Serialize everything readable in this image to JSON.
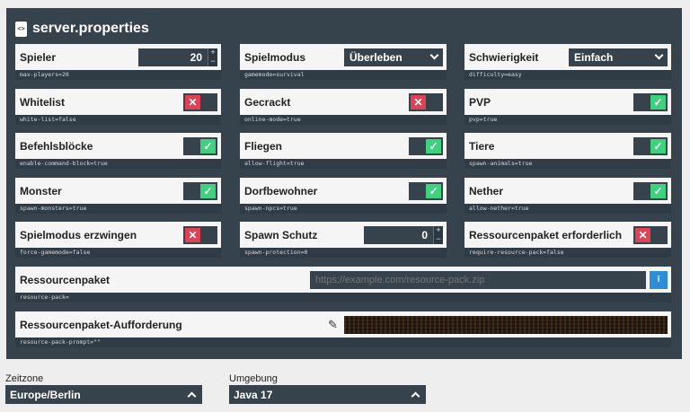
{
  "title": "server.properties",
  "file_icon_glyph": "<>",
  "properties": {
    "max_players": {
      "label": "Spieler",
      "key": "max-players=20",
      "value": "20"
    },
    "gamemode": {
      "label": "Spielmodus",
      "key": "gamemode=survival",
      "value": "Überleben"
    },
    "difficulty": {
      "label": "Schwierigkeit",
      "key": "difficulty=easy",
      "value": "Einfach"
    },
    "white_list": {
      "label": "Whitelist",
      "key": "white-list=false",
      "state": "off"
    },
    "online_mode": {
      "label": "Gecrackt",
      "key": "online-mode=true",
      "state": "off"
    },
    "pvp": {
      "label": "PVP",
      "key": "pvp=true",
      "state": "on"
    },
    "command_block": {
      "label": "Befehlsblöcke",
      "key": "enable-command-block=true",
      "state": "on"
    },
    "allow_flight": {
      "label": "Fliegen",
      "key": "allow-flight=true",
      "state": "on"
    },
    "spawn_animals": {
      "label": "Tiere",
      "key": "spawn-animals=true",
      "state": "on"
    },
    "spawn_monsters": {
      "label": "Monster",
      "key": "spawn-monsters=true",
      "state": "on"
    },
    "spawn_npcs": {
      "label": "Dorfbewohner",
      "key": "spawn-npcs=true",
      "state": "on"
    },
    "allow_nether": {
      "label": "Nether",
      "key": "allow-nether=true",
      "state": "on"
    },
    "force_gamemode": {
      "label": "Spielmodus erzwingen",
      "key": "force-gamemode=false",
      "state": "off"
    },
    "spawn_protection": {
      "label": "Spawn Schutz",
      "key": "spawn-protection=0",
      "value": "0"
    },
    "require_resource_pack": {
      "label": "Ressourcenpaket erforderlich",
      "key": "require-resource-pack=false",
      "state": "off"
    },
    "resource_pack": {
      "label": "Ressourcenpaket",
      "key": "resource-pack=",
      "placeholder": "https://example.com/resource-pack.zip"
    },
    "resource_pack_prompt": {
      "label": "Ressourcenpaket-Aufforderung",
      "key": "resource-pack-prompt=\"\""
    }
  },
  "stepper": {
    "plus": "+",
    "minus": "−"
  },
  "toggle_glyphs": {
    "on": "✓",
    "off": "✕"
  },
  "icons": {
    "upload": "upload-icon",
    "pencil": "pencil-icon",
    "file": "file-code-icon"
  },
  "bottom": {
    "timezone": {
      "label": "Zeitzone",
      "value": "Europe/Berlin"
    },
    "environment": {
      "label": "Umgebung",
      "value": "Java 17"
    }
  },
  "colors": {
    "toggle_on": "#3fd17e",
    "toggle_off": "#e04155",
    "panel": "#36434d",
    "upload": "#2d8ed7"
  }
}
